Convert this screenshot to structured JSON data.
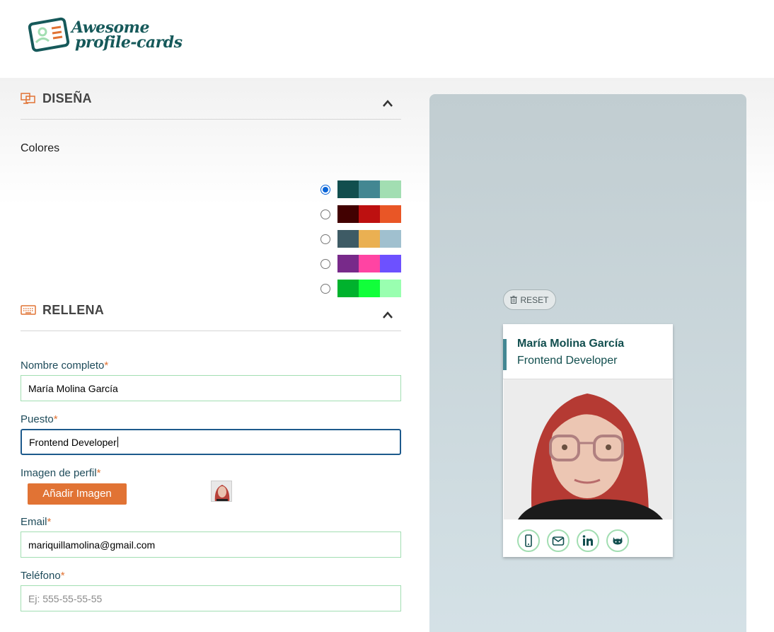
{
  "header": {
    "logo_line1": "Awesome",
    "logo_line2": "profile-cards",
    "logo_icon": "id-card-icon"
  },
  "design": {
    "title": "DISEÑA",
    "icon": "design-icon",
    "colors_label": "Colores",
    "palettes": [
      {
        "selected": true,
        "colors": [
          "#114e4e",
          "#438792",
          "#a2deb2"
        ]
      },
      {
        "selected": false,
        "colors": [
          "#420101",
          "#bd1010",
          "#e95626"
        ]
      },
      {
        "selected": false,
        "colors": [
          "#3e5b65",
          "#eab052",
          "#a0c0cf"
        ]
      },
      {
        "selected": false,
        "colors": [
          "#782a8a",
          "#ff44a3",
          "#6d51ff"
        ]
      },
      {
        "selected": false,
        "colors": [
          "#00b22d",
          "#11ff3a",
          "#99ffb0"
        ]
      }
    ]
  },
  "fill": {
    "title": "RELLENA",
    "icon": "keyboard-icon",
    "name_label": "Nombre completo",
    "name_value": "María Molina García",
    "job_label": "Puesto",
    "job_value": "Frontend Developer",
    "image_label": "Imagen de perfil",
    "add_image_label": "Añadir Imagen",
    "email_label": "Email",
    "email_value": "mariquillamolina@gmail.com",
    "phone_label": "Teléfono",
    "phone_placeholder": "Ej: 555-55-55-55",
    "required_mark": "*"
  },
  "preview": {
    "reset_label": "RESET",
    "card_name": "María Molina García",
    "card_job": "Frontend Developer",
    "social_icons": [
      "mobile-icon",
      "envelope-icon",
      "linkedin-icon",
      "github-icon"
    ]
  },
  "colors": {
    "accent": "#e17334",
    "primary": "#114e4e",
    "field_border": "#a2deb2"
  }
}
